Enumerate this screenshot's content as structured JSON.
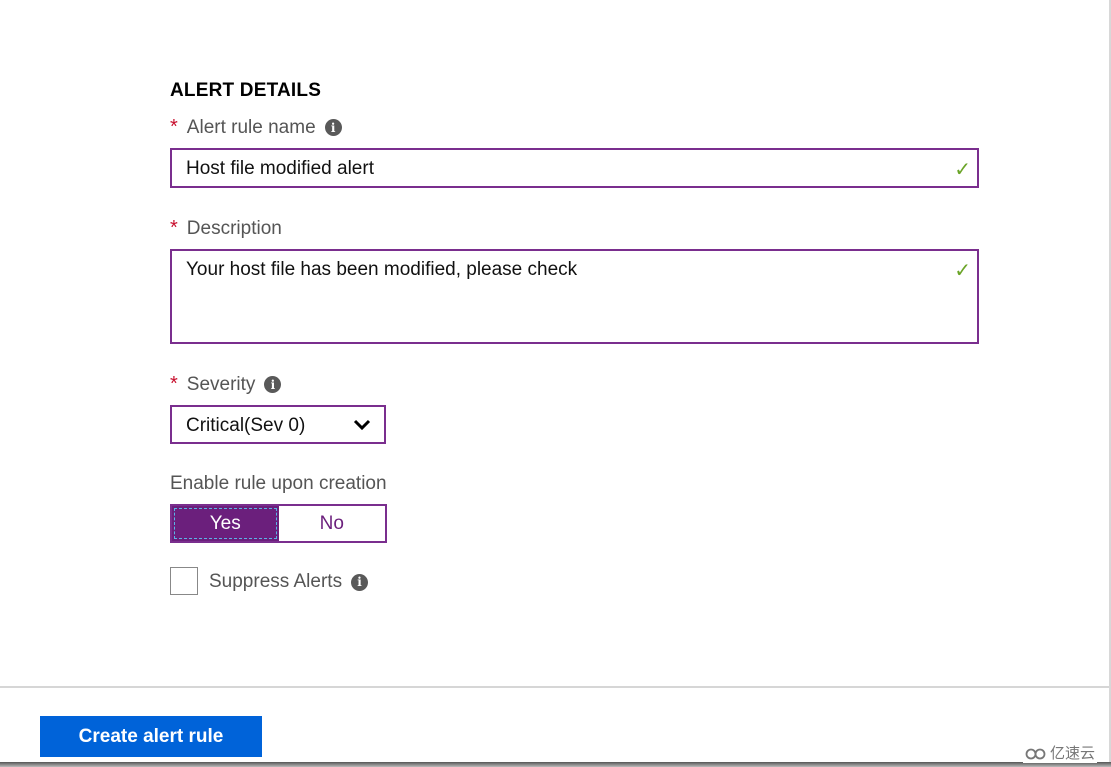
{
  "section": {
    "title": "ALERT DETAILS"
  },
  "alert_rule_name": {
    "required_mark": "*",
    "label": "Alert rule name",
    "info_icon": "i",
    "value": "Host file modified alert",
    "valid_icon": "✓"
  },
  "description": {
    "required_mark": "*",
    "label": "Description",
    "value": "Your host file has been modified, please check",
    "valid_icon": "✓"
  },
  "severity": {
    "required_mark": "*",
    "label": "Severity",
    "info_icon": "i",
    "selected": "Critical(Sev 0)"
  },
  "enable_rule": {
    "label": "Enable rule upon creation",
    "options": [
      "Yes",
      "No"
    ],
    "selected": "Yes"
  },
  "suppress_alerts": {
    "label": "Suppress Alerts",
    "info_icon": "i",
    "checked": false
  },
  "footer": {
    "create_button": "Create alert rule"
  },
  "watermark": {
    "text": "亿速云"
  }
}
